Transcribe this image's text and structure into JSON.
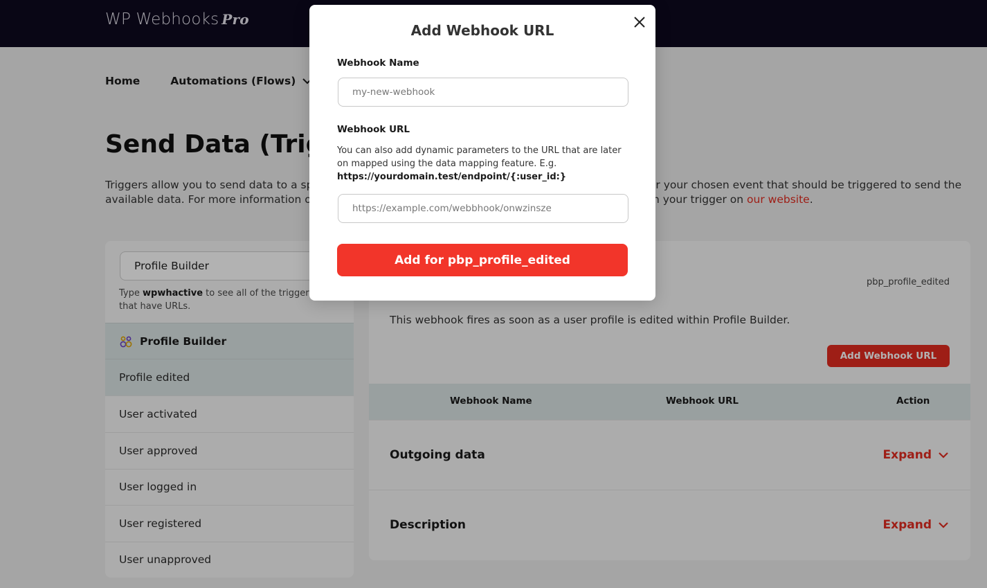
{
  "brand": {
    "name": "WP Webhooks",
    "suffix": "Pro"
  },
  "nav": {
    "home": "Home",
    "automations": "Automations (Flows)"
  },
  "page": {
    "title": "Send Data (Triggers)",
    "intro_text": "Triggers allow you to send data to a specific URL once a certain event happens. Simply add the URL for your chosen event that should be triggered to send the available data. For more information on how to use triggers, please check our documentation and then your trigger on ",
    "intro_link": "our website",
    "intro_end": "."
  },
  "sidebar": {
    "search_value": "Profile Builder",
    "hint_prefix": "Type ",
    "hint_keyword": "wpwhactive",
    "hint_suffix": " to see all of the triggers that have URLs.",
    "group_label": "Profile Builder",
    "items": [
      {
        "label": "Profile edited"
      },
      {
        "label": "User activated"
      },
      {
        "label": "User approved"
      },
      {
        "label": "User logged in"
      },
      {
        "label": "User registered"
      },
      {
        "label": "User unapproved"
      }
    ]
  },
  "details": {
    "slug": "pbp_profile_edited",
    "description": "This webhook fires as soon as a user profile is edited within Profile Builder.",
    "add_button": "Add Webhook URL",
    "table_headers": {
      "name": "Webhook Name",
      "url": "Webhook URL",
      "action": "Action"
    },
    "sections": [
      {
        "title": "Outgoing data",
        "expand": "Expand"
      },
      {
        "title": "Description",
        "expand": "Expand"
      }
    ]
  },
  "modal": {
    "title": "Add Webhook URL",
    "name_label": "Webhook Name",
    "name_placeholder": "my-new-webhook",
    "url_label": "Webhook URL",
    "help_text": "You can also add dynamic parameters to the URL that are later on mapped using the data mapping feature. E.g.",
    "help_example": "https://yourdomain.test/endpoint/{:user_id:}",
    "url_placeholder": "https://example.com/webbhook/onwzinsze",
    "submit": "Add for pbp_profile_edited"
  },
  "colors": {
    "accent": "#e22b20",
    "header_bg": "#0e0a1f",
    "highlight": "#dce6e6"
  },
  "icons": [
    "chevron-down-icon",
    "profile-builder-icon",
    "close-icon"
  ]
}
